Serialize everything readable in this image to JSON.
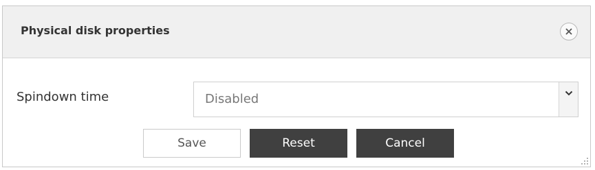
{
  "dialog": {
    "title": "Physical disk properties",
    "close_icon": "close-icon"
  },
  "form": {
    "spindown": {
      "label": "Spindown time",
      "selected_value": "Disabled",
      "arrow_icon": "chevron-down-icon"
    }
  },
  "buttons": {
    "save_label": "Save",
    "reset_label": "Reset",
    "cancel_label": "Cancel"
  },
  "colors": {
    "titlebar_bg": "#f0f0f0",
    "dark_button": "#404040"
  }
}
